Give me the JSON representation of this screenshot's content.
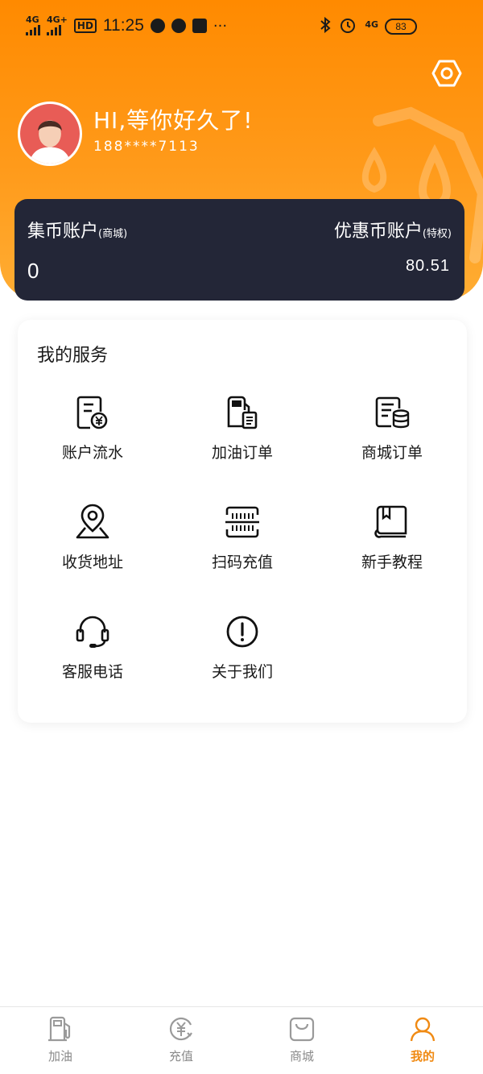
{
  "status_bar": {
    "time": "11:25",
    "network_1": "4G",
    "network_2": "4G+",
    "hd": "HD",
    "network_3": "4G",
    "battery": "83",
    "more": "···"
  },
  "header": {
    "greeting": "HI,等你好久了!",
    "phone": "188****7113"
  },
  "account": {
    "left_title": "集币账户",
    "left_sub": "(商城)",
    "left_value": "0",
    "right_title": "优惠币账户",
    "right_sub": "(特权)",
    "right_value": "80.51"
  },
  "services": {
    "title": "我的服务",
    "items": [
      {
        "label": "账户流水",
        "icon": "account-statement-icon"
      },
      {
        "label": "加油订单",
        "icon": "fuel-order-icon"
      },
      {
        "label": "商城订单",
        "icon": "mall-order-icon"
      },
      {
        "label": "收货地址",
        "icon": "location-pin-icon"
      },
      {
        "label": "扫码充值",
        "icon": "scan-code-icon"
      },
      {
        "label": "新手教程",
        "icon": "book-icon"
      },
      {
        "label": "客服电话",
        "icon": "headset-icon"
      },
      {
        "label": "关于我们",
        "icon": "info-icon"
      }
    ]
  },
  "tabbar": {
    "items": [
      {
        "label": "加油",
        "icon": "fuel-pump-icon"
      },
      {
        "label": "充值",
        "icon": "recharge-icon"
      },
      {
        "label": "商城",
        "icon": "shopping-bag-icon"
      },
      {
        "label": "我的",
        "icon": "user-icon"
      }
    ],
    "active_index": 3
  },
  "colors": {
    "brand_orange": "#ff8a00",
    "card_dark": "#232637",
    "active_tab": "#f08a13"
  }
}
